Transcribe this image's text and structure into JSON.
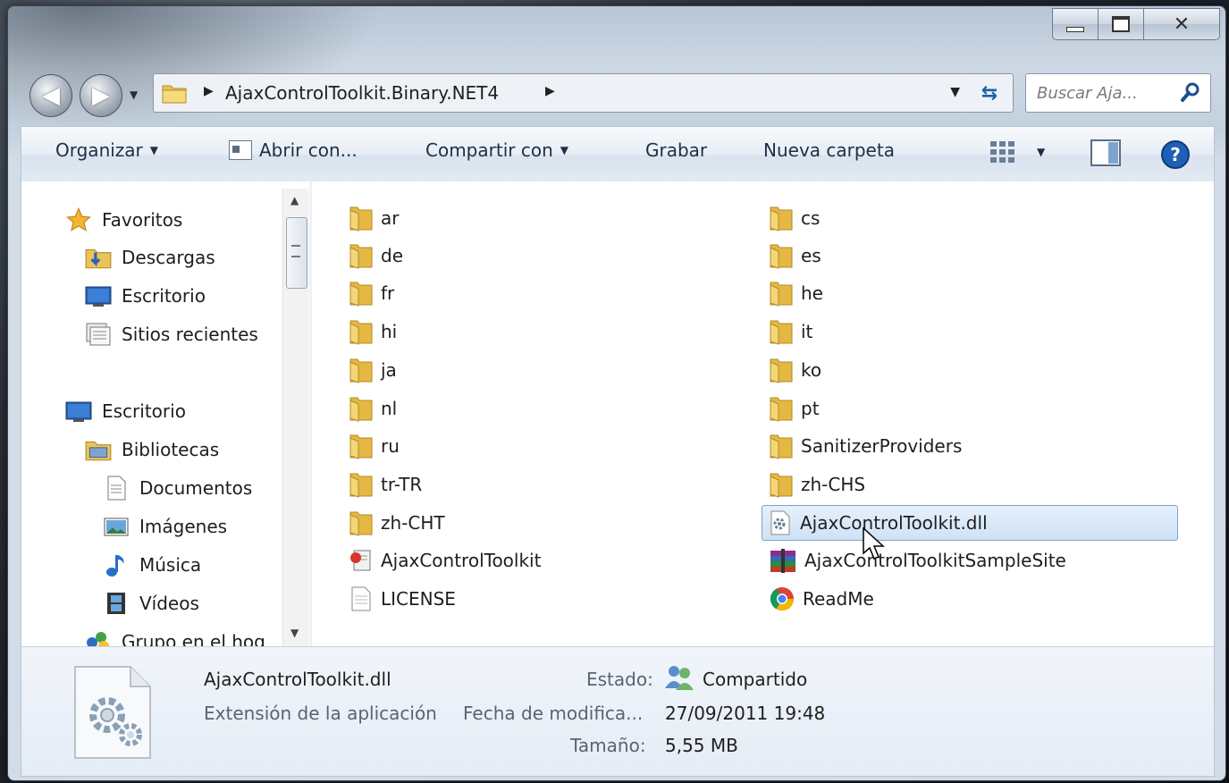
{
  "address": {
    "crumb": "AjaxControlToolkit.Binary.NET4"
  },
  "search": {
    "placeholder": "Buscar Aja..."
  },
  "toolbar": {
    "organize": "Organizar",
    "open_with": "Abrir con...",
    "share_with": "Compartir con",
    "burn": "Grabar",
    "new_folder": "Nueva carpeta"
  },
  "sidebar": {
    "favorites": "Favoritos",
    "downloads": "Descargas",
    "desktop_fav": "Escritorio",
    "recent": "Sitios recientes",
    "desktop": "Escritorio",
    "libraries": "Bibliotecas",
    "documents": "Documentos",
    "pictures": "Imágenes",
    "music": "Música",
    "videos": "Vídeos",
    "homegroup": "Grupo en el hog"
  },
  "files": {
    "left": [
      "ar",
      "de",
      "fr",
      "hi",
      "ja",
      "nl",
      "ru",
      "tr-TR",
      "zh-CHT",
      "AjaxControlToolkit",
      "LICENSE"
    ],
    "right": [
      "cs",
      "es",
      "he",
      "it",
      "ko",
      "pt",
      "SanitizerProviders",
      "zh-CHS",
      "AjaxControlToolkit.dll",
      "AjaxControlToolkitSampleSite",
      "ReadMe"
    ]
  },
  "details": {
    "name": "AjaxControlToolkit.dll",
    "type": "Extensión de la aplicación",
    "state_label": "Estado:",
    "state_value": "Compartido",
    "modified_label": "Fecha de modifica...",
    "modified_value": "27/09/2011 19:48",
    "size_label": "Tamaño:",
    "size_value": "5,55 MB"
  }
}
